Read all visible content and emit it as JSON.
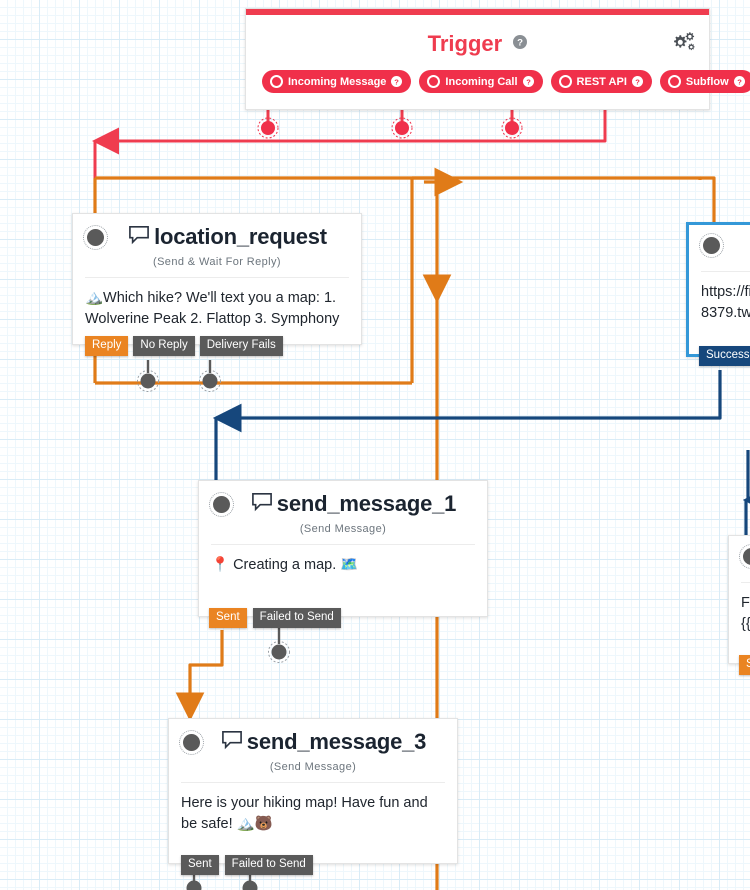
{
  "canvas": {
    "grid": true,
    "bg": "#ffffff",
    "grid_color": "#d9ecf7"
  },
  "colors": {
    "trigger_red": "#ef3c4f",
    "pill_red": "#f0304a",
    "orange": "#e07b18",
    "navy": "#16477c",
    "blue_border": "#3498d8",
    "gray_badge": "#5a5a5a",
    "orange_badge": "#ea8422"
  },
  "trigger": {
    "title": "Trigger",
    "help_icon": "help-icon",
    "settings_icon": "gears-icon",
    "pills": [
      {
        "label": "Incoming Message",
        "icon": "radio-circle-icon",
        "help": "help-icon"
      },
      {
        "label": "Incoming Call",
        "icon": "radio-circle-icon",
        "help": "help-icon"
      },
      {
        "label": "REST API",
        "icon": "radio-circle-icon",
        "help": "help-icon"
      },
      {
        "label": "Subflow",
        "icon": "radio-circle-icon",
        "help": "help-icon"
      }
    ]
  },
  "nodes": [
    {
      "id": "location_request",
      "name": "location_request",
      "subtitle": "(Send & Wait For Reply)",
      "body": "🏔️Which hike? We'll text you a map: 1. Wolverine Peak 2. Flattop 3. Symphony",
      "icon": "chat-bubble-icon",
      "badges": [
        {
          "label": "Reply",
          "style": "orange"
        },
        {
          "label": "No Reply",
          "style": "gray"
        },
        {
          "label": "Delivery Fails",
          "style": "gray"
        }
      ]
    },
    {
      "id": "send_message_1",
      "name": "send_message_1",
      "subtitle": "(Send Message)",
      "body": "📍 Creating a map. 🗺️",
      "icon": "chat-bubble-icon",
      "badges": [
        {
          "label": "Sent",
          "style": "orange"
        },
        {
          "label": "Failed to Send",
          "style": "gray"
        }
      ]
    },
    {
      "id": "send_message_3",
      "name": "send_message_3",
      "subtitle": "(Send Message)",
      "body": "Here is your hiking map! Have fun and be safe! 🏔️🐻",
      "icon": "chat-bubble-icon",
      "badges": [
        {
          "label": "Sent",
          "style": "gray"
        },
        {
          "label": "Failed to Send",
          "style": "gray"
        }
      ]
    },
    {
      "id": "rest_api_node",
      "name": "",
      "subtitle": "",
      "body": "https://fi\n8379.tw",
      "icon": "",
      "badges": [
        {
          "label": "Success",
          "style": "navy"
        }
      ]
    },
    {
      "id": "failed_node",
      "name": "",
      "subtitle": "",
      "body": "Fa\n{{v",
      "icon": "",
      "badges": [
        {
          "label": "Se",
          "style": "orange"
        }
      ]
    }
  ]
}
